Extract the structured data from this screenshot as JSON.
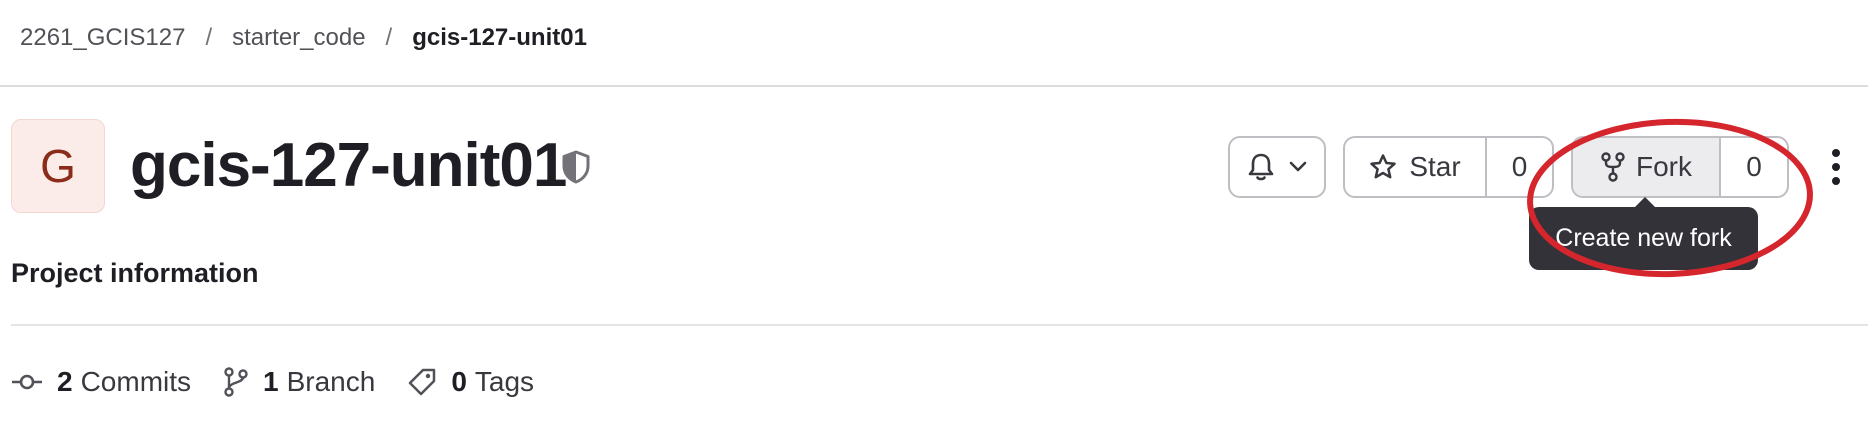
{
  "breadcrumb": {
    "group": "2261_GCIS127",
    "subgroup": "starter_code",
    "project": "gcis-127-unit01",
    "separator": "/"
  },
  "project": {
    "avatar_letter": "G",
    "title": "gcis-127-unit01",
    "visibility_icon": "shield-icon"
  },
  "actions": {
    "notifications_icon": "bell-icon",
    "star_label": "Star",
    "star_count": "0",
    "fork_label": "Fork",
    "fork_count": "0",
    "more_icon": "vertical-ellipsis-icon"
  },
  "tooltip": {
    "text": "Create new fork"
  },
  "section": {
    "title": "Project information"
  },
  "stats": [
    {
      "icon": "commit-icon",
      "count": "2",
      "label": "Commits"
    },
    {
      "icon": "branch-icon",
      "count": "1",
      "label": "Branch"
    },
    {
      "icon": "tag-icon",
      "count": "0",
      "label": "Tags"
    }
  ],
  "colors": {
    "annotation": "#d4262c",
    "tooltip_bg": "#333238",
    "avatar_bg": "#fcece9",
    "avatar_text": "#8b2b1a"
  }
}
